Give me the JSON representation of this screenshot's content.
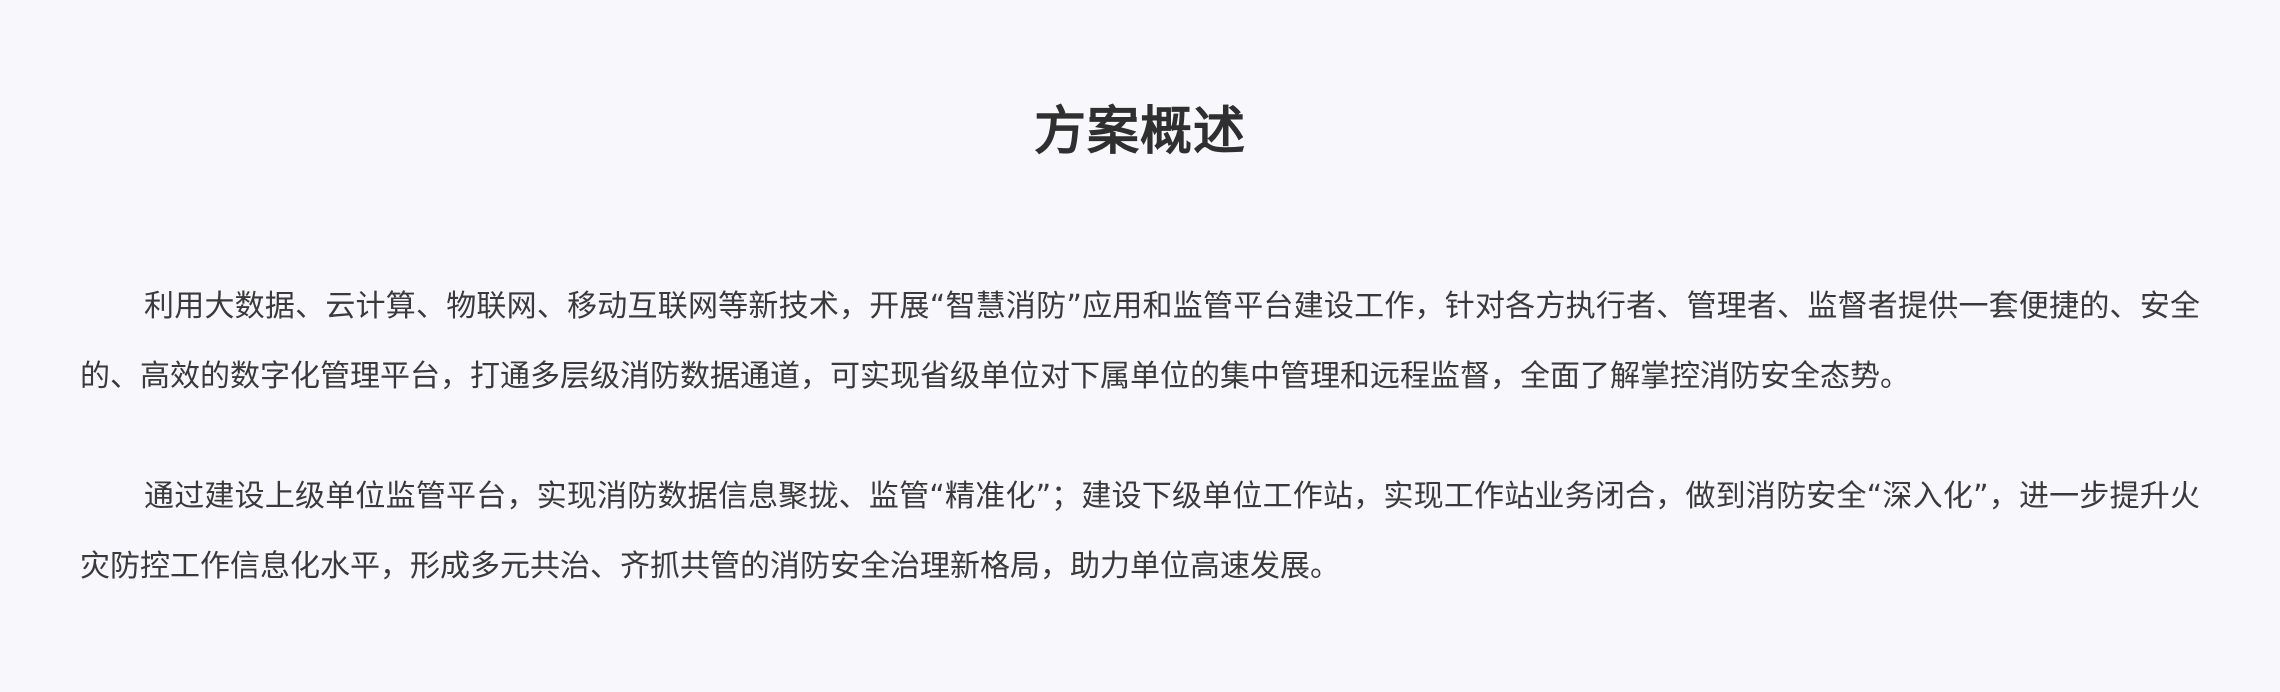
{
  "page": {
    "title": "方案概述",
    "paragraphs": [
      "利用大数据、云计算、物联网、移动互联网等新技术，开展“智慧消防”应用和监管平台建设工作，针对各方执行者、管理者、监督者提供一套便捷的、安全的、高效的数字化管理平台，打通多层级消防数据通道，可实现省级单位对下属单位的集中管理和远程监督，全面了解掌控消防安全态势。",
      "通过建设上级单位监管平台，实现消防数据信息聚拢、监管“精准化”；建设下级单位工作站，实现工作站业务闭合，做到消防安全“深入化”，进一步提升火灾防控工作信息化水平，形成多元共治、齐抓共管的消防安全治理新格局，助力单位高速发展。"
    ]
  }
}
